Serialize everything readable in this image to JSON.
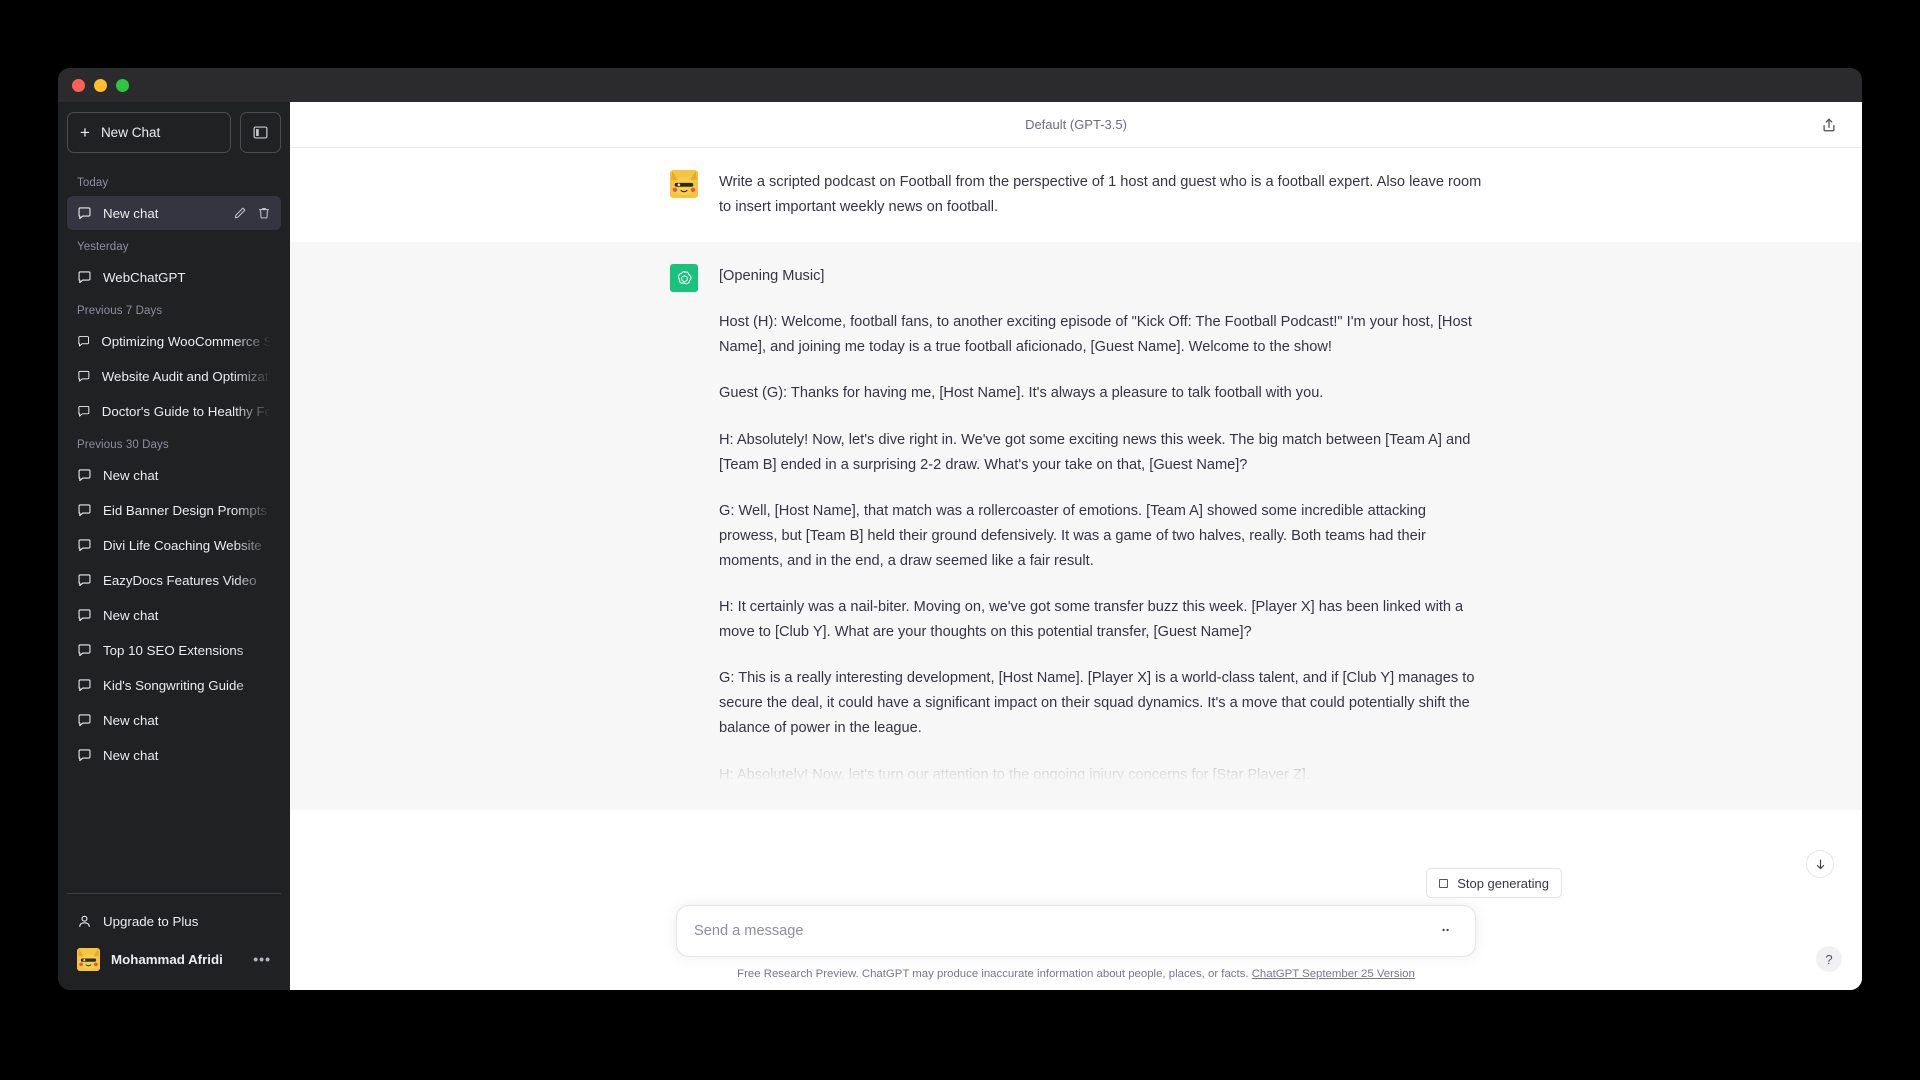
{
  "window": {
    "traffic_lights": [
      "close",
      "minimize",
      "zoom"
    ]
  },
  "sidebar": {
    "new_chat_label": "New Chat",
    "new_chat_icon": "plus-icon",
    "toggle_icon": "sidebar-toggle-icon",
    "groups": [
      {
        "label": "Today",
        "items": [
          {
            "title": "New chat",
            "icon": "chat-bubble-icon",
            "active": true,
            "actions": [
              "edit-icon",
              "trash-icon"
            ]
          }
        ]
      },
      {
        "label": "Yesterday",
        "items": [
          {
            "title": "WebChatGPT",
            "icon": "chat-bubble-icon",
            "active": false
          }
        ]
      },
      {
        "label": "Previous 7 Days",
        "items": [
          {
            "title": "Optimizing WooCommerce SEO",
            "icon": "chat-bubble-icon",
            "active": false
          },
          {
            "title": "Website Audit and Optimization",
            "icon": "chat-bubble-icon",
            "active": false
          },
          {
            "title": "Doctor's Guide to Healthy Food",
            "icon": "chat-bubble-icon",
            "active": false
          }
        ]
      },
      {
        "label": "Previous 30 Days",
        "items": [
          {
            "title": "New chat",
            "icon": "chat-bubble-icon",
            "active": false
          },
          {
            "title": "Eid Banner Design Prompts",
            "icon": "chat-bubble-icon",
            "active": false
          },
          {
            "title": "Divi Life Coaching Website",
            "icon": "chat-bubble-icon",
            "active": false
          },
          {
            "title": "EazyDocs Features Video",
            "icon": "chat-bubble-icon",
            "active": false
          },
          {
            "title": "New chat",
            "icon": "chat-bubble-icon",
            "active": false
          },
          {
            "title": "Top 10 SEO Extensions",
            "icon": "chat-bubble-icon",
            "active": false
          },
          {
            "title": "Kid's Songwriting Guide",
            "icon": "chat-bubble-icon",
            "active": false
          },
          {
            "title": "New chat",
            "icon": "chat-bubble-icon",
            "active": false
          },
          {
            "title": "New chat",
            "icon": "chat-bubble-icon",
            "active": false
          }
        ]
      }
    ],
    "upgrade_label": "Upgrade to Plus",
    "upgrade_icon": "person-icon",
    "user_name": "Mohammad Afridi",
    "user_avatar": "pikachu-avatar",
    "user_menu_dots": "•••"
  },
  "header": {
    "model_label": "Default (GPT-3.5)",
    "share_icon": "share-upload-icon"
  },
  "messages": [
    {
      "role": "user",
      "avatar": "pikachu-avatar",
      "paragraphs": [
        "Write a scripted podcast on Football from the perspective of 1 host and guest who is a football expert. Also leave room to insert important weekly news on football."
      ]
    },
    {
      "role": "assistant",
      "avatar": "chatgpt-logo-icon",
      "paragraphs": [
        "[Opening Music]",
        "Host (H): Welcome, football fans, to another exciting episode of \"Kick Off: The Football Podcast!\" I'm your host, [Host Name], and joining me today is a true football aficionado, [Guest Name]. Welcome to the show!",
        "Guest (G): Thanks for having me, [Host Name]. It's always a pleasure to talk football with you.",
        "H: Absolutely! Now, let's dive right in. We've got some exciting news this week. The big match between [Team A] and [Team B] ended in a surprising 2-2 draw. What's your take on that, [Guest Name]?",
        "G: Well, [Host Name], that match was a rollercoaster of emotions. [Team A] showed some incredible attacking prowess, but [Team B] held their ground defensively. It was a game of two halves, really. Both teams had their moments, and in the end, a draw seemed like a fair result.",
        "H: It certainly was a nail-biter. Moving on, we've got some transfer buzz this week. [Player X] has been linked with a move to [Club Y]. What are your thoughts on this potential transfer, [Guest Name]?",
        "G: This is a really interesting development, [Host Name]. [Player X] is a world-class talent, and if [Club Y] manages to secure the deal, it could have a significant impact on their squad dynamics. It's a move that could potentially shift the balance of power in the league.",
        "H: Absolutely! Now, let's turn our attention to the ongoing injury concerns for [Star Player Z]."
      ]
    }
  ],
  "controls": {
    "stop_generating_label": "Stop generating",
    "stop_generating_icon": "stop-square-icon",
    "scroll_down_icon": "arrow-down-icon",
    "help_icon": "question-mark-icon"
  },
  "composer": {
    "placeholder": "Send a message",
    "value": "",
    "send_icon": "send-dots-icon"
  },
  "footer": {
    "note_text": "Free Research Preview. ChatGPT may produce inaccurate information about people, places, or facts. ",
    "link_text": "ChatGPT September 25 Version"
  },
  "colors": {
    "sidebar_bg": "#202123",
    "active_item_bg": "#343541",
    "assistant_row_bg": "#f7f7f8",
    "gpt_green": "#19c37d",
    "text_primary": "#343541"
  }
}
